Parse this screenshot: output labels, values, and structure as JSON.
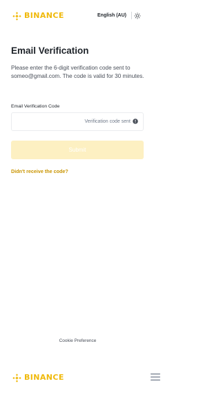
{
  "header": {
    "logo_text": "BINANCE",
    "language": "English (AU)",
    "theme_icon": "sun-icon"
  },
  "main": {
    "title": "Email Verification",
    "description": "Please enter the 6-digit verification code sent to someo@gmail.com. The code is valid for 30 minutes.",
    "field_label": "Email Verification Code",
    "code_value": "",
    "code_status": "Verification code sent",
    "status_icon": "info-icon",
    "submit_label": "Submit",
    "resend_link": "Didn't receive the code?"
  },
  "footer": {
    "cookie_label": "Cookie Preference",
    "logo_text": "BINANCE",
    "menu_icon": "hamburger-menu-icon"
  },
  "colors": {
    "brand": "#f0b90b",
    "link": "#c99400",
    "submit_disabled_bg": "#fdf0c2",
    "text_primary": "#1e2329",
    "text_secondary": "#474d57",
    "text_muted": "#707a8a",
    "border": "#eaecef"
  }
}
